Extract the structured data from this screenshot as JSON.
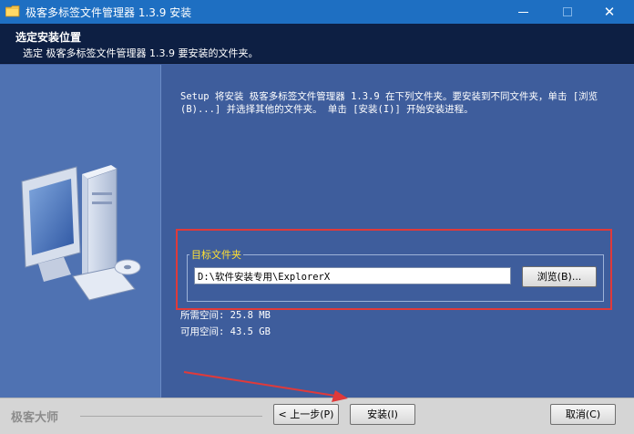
{
  "window": {
    "title": "极客多标签文件管理器 1.3.9 安装",
    "minimize_label": "—",
    "maximize_label": "□",
    "close_label": "✕"
  },
  "header": {
    "title": "选定安装位置",
    "subtitle": "选定 极客多标签文件管理器 1.3.9 要安装的文件夹。"
  },
  "content": {
    "intro": "Setup 将安装 极客多标签文件管理器 1.3.9 在下列文件夹。要安装到不同文件夹，单击 [浏览(B)...] 并选择其他的文件夹。 单击 [安装(I)] 开始安装进程。",
    "group_label": "目标文件夹",
    "path_value": "D:\\软件安装专用\\ExplorerX",
    "browse_label": "浏览(B)...",
    "space_required": "所需空间: 25.8 MB",
    "space_available": "可用空间: 43.5 GB"
  },
  "footer": {
    "brand": "极客大师",
    "back_label": "< 上一步(P)",
    "install_label": "安装(I)",
    "cancel_label": "取消(C)"
  },
  "colors": {
    "titlebar": "#1e6fc2",
    "header": "#0d1f43",
    "body": "#3e5d9c",
    "group_label": "#ffe033",
    "annotation": "#e03a3a"
  },
  "icons": [
    "folder-app-icon",
    "computer-illustration",
    "annotation-arrow"
  ]
}
